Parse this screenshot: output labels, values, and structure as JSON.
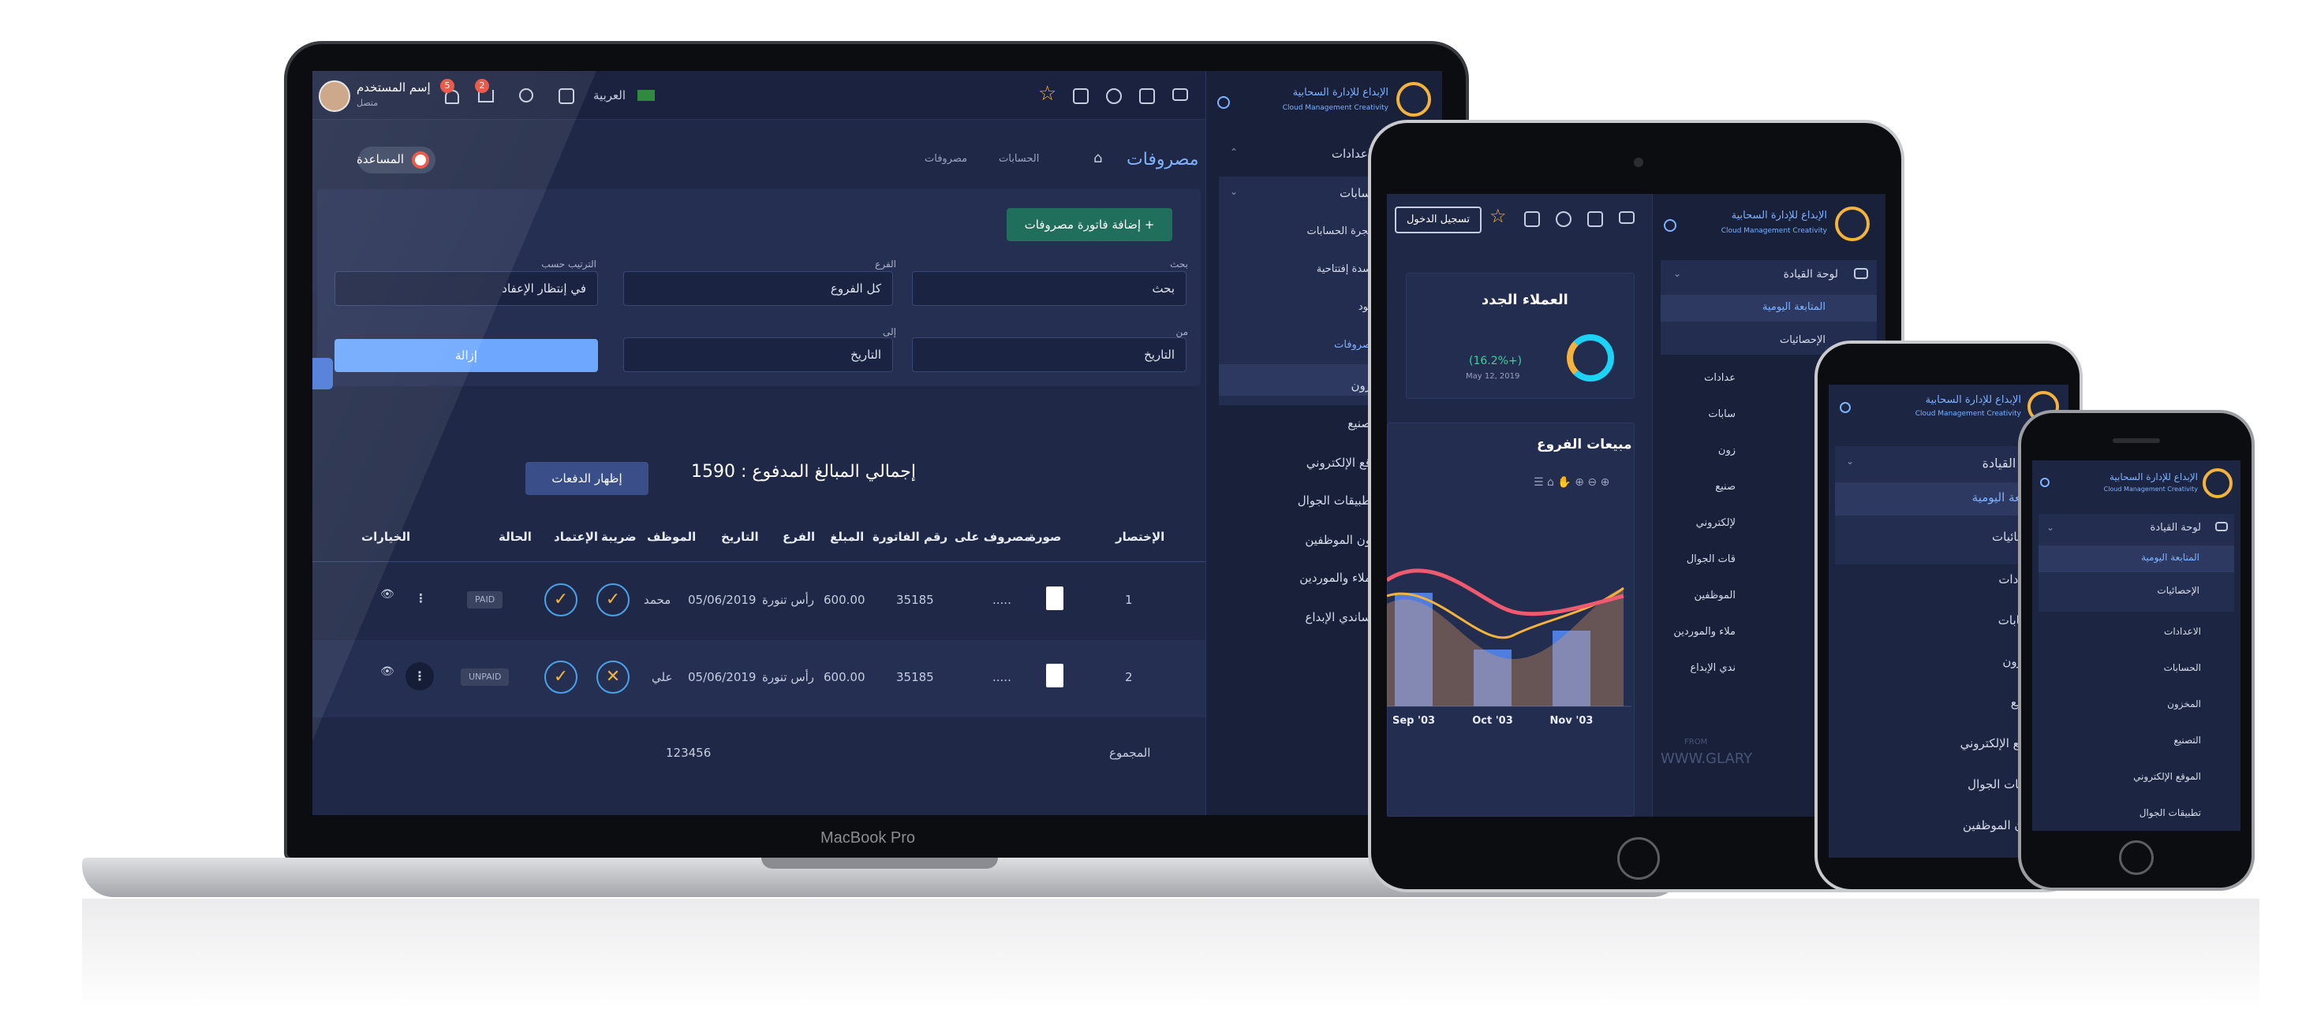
{
  "desktop": {
    "logo_ar": "الإبداع للإدارة السحابية",
    "logo_en": "Cloud Management Creativity",
    "user_name": "إسم المستخدم",
    "user_status": "متصل",
    "badge_notifications": "5",
    "badge_cart": "2",
    "language": "العربية",
    "page_title": "مصروفات",
    "breadcrumb_1": "الحسابات",
    "breadcrumb_2": "مصروفات",
    "help_label": "المساعدة",
    "add_invoice_label": "إضافة فاتورة مصروفات +",
    "search_label": "بحث",
    "search_placeholder": "بحث",
    "branch_label": "الفرع",
    "branch_value": "كل الفروع",
    "sort_label": "الترتيب حسب",
    "sort_value": "في إنتظار الإعفاد",
    "from_label": "من",
    "from_placeholder": "التاريخ",
    "to_label": "إلى",
    "to_placeholder": "التاريخ",
    "clear_label": "إزالة",
    "total_paid_label": "إجمالي المبالغ المدفوع : 1590",
    "show_payments_label": "إظهار الدفعات",
    "table_headers": [
      "الإختصار",
      "صورة",
      "مصروف على",
      "رقم الفاتورة",
      "المبلغ",
      "الفرع",
      "التاريخ",
      "الموظف",
      "ضريبة",
      "الإعتماد",
      "الحالة",
      "الخيارات"
    ],
    "rows": [
      {
        "index": "1",
        "expense_on": ".....",
        "invoice": "35185",
        "amount": "600.00",
        "branch": "رأس تنورة",
        "date": "05/06/2019",
        "employee": "محمد",
        "tax": "✓",
        "approval": "✓",
        "status": "PAID"
      },
      {
        "index": "2",
        "expense_on": ".....",
        "invoice": "35185",
        "amount": "600.00",
        "branch": "رأس تنورة",
        "date": "05/06/2019",
        "employee": "علي",
        "tax": "✕",
        "approval": "✓",
        "status": "UNPAID"
      }
    ],
    "sum_label": "المجموع",
    "sum_value": "123456",
    "sidebar": [
      "اعدادات",
      "سابات",
      "يجرة الحسابات",
      "سدة إفتتاحية",
      "يود",
      "صروفات",
      "زون",
      "صنيع",
      "قع الإلكتروني",
      "طبيقات الجوال",
      "ون الموظفين",
      "ملاء والموردين",
      "ساندي الإبداع"
    ],
    "brand": "MacBook Pro"
  },
  "tablet": {
    "login_label": "تسجيل الدخول",
    "dashboard": "لوحة القيادة",
    "daily": "المتابعة اليومية",
    "stats": "الإحصائيات",
    "menu": [
      "عدادات",
      "سابات",
      "زون",
      "صنيع",
      "لإلكتروني",
      "قات الجوال",
      "الموظفين",
      "ملاء والموردين",
      "ندي الإبداع"
    ],
    "new_customers_title": "العملاء الجدد",
    "new_customers_change": "(16.2%+)",
    "new_customers_date": "May 12, 2019",
    "branch_sales_title": "مبيعات الفروع",
    "watermark_from": "FROM",
    "watermark": "WWW.GLARY"
  },
  "chart_data": {
    "type": "bar",
    "categories": [
      "Sep '03",
      "Oct '03",
      "Nov '03"
    ],
    "series": [
      {
        "name": "",
        "values": [
          60,
          30,
          40
        ]
      },
      {
        "name": "",
        "values": [
          80,
          66,
          70
        ]
      },
      {
        "name": "",
        "values": [
          72,
          52,
          60
        ]
      }
    ],
    "title": "مبيعات الفروع",
    "xlabel": "",
    "ylabel": "",
    "ylim": [
      0,
      100
    ]
  },
  "phone1": {
    "dashboard": "لوحة القيادة",
    "daily": "المتابعة اليومية",
    "stats": "الإحصائيات",
    "menu": [
      "الاعدادات",
      "الحسابات",
      "المخزون",
      "التصنيع",
      "الموقع الإلكتروني",
      "تطبيقات الجوال",
      "شؤون الموظفين"
    ]
  },
  "phone2": {
    "dashboard": "لوحة القيادة",
    "daily": "المتابعة اليومية",
    "stats": "الإحصائيات",
    "menu": [
      "الاعدادات",
      "الحسابات",
      "المخزون",
      "التصنيع",
      "الموقع الإلكتروني",
      "تطبيقات الجوال"
    ]
  },
  "colors": {
    "accent": "#f3b33d",
    "primary": "#6ea8fe",
    "dark_bg": "#1c2541",
    "green_btn": "#1f6f5c"
  }
}
